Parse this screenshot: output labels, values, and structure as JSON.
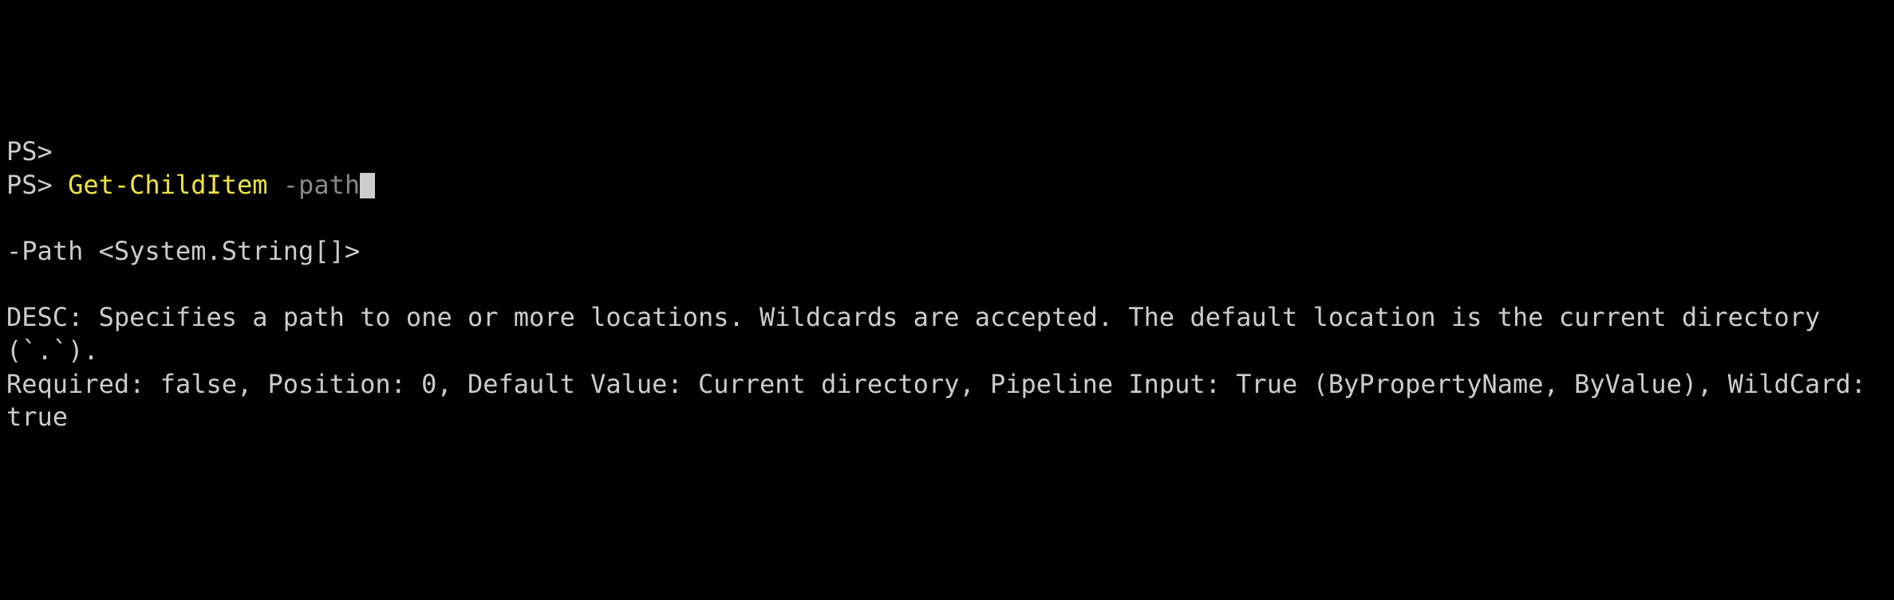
{
  "terminal": {
    "line1": {
      "prompt": "PS>"
    },
    "line2": {
      "prompt": "PS> ",
      "cmdlet": "Get-ChildItem",
      "space": " ",
      "param": "-path"
    },
    "help": {
      "signature": "-Path <System.String[]>",
      "desc_label": "DESC: ",
      "desc_text": "Specifies a path to one or more locations. Wildcards are accepted. The default location is the current directory (`.`).",
      "required_line": "Required: false, Position: 0, Default Value: Current directory, Pipeline Input: True (ByPropertyName, ByValue), WildCard: true"
    }
  }
}
